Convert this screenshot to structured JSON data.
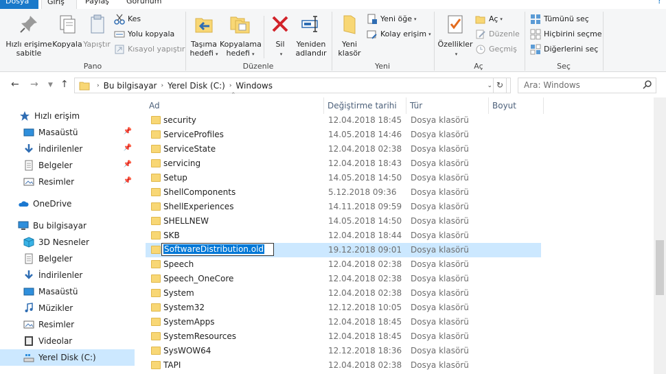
{
  "tabs": {
    "items": [
      "Dosya",
      "Giriş",
      "Paylaş",
      "Görünüm"
    ]
  },
  "ribbon": {
    "pano": {
      "label": "Pano",
      "pin": "Hızlı erişime sabitle",
      "copy": "Kopyala",
      "paste": "Yapıştır",
      "cut": "Kes",
      "copy_path": "Yolu kopyala",
      "paste_shortcut": "Kısayol yapıştır"
    },
    "duzenle": {
      "label": "Düzenle",
      "move_to": "Taşıma hedefi",
      "copy_to": "Kopyalama hedefi",
      "delete": "Sil",
      "rename": "Yeniden adlandır"
    },
    "yeni": {
      "label": "Yeni",
      "new_folder": "Yeni klasör",
      "new_item": "Yeni öğe",
      "easy_access": "Kolay erişim"
    },
    "ac": {
      "label": "Aç",
      "properties": "Özellikler",
      "open": "Aç",
      "edit": "Düzenle",
      "history": "Geçmiş"
    },
    "sec": {
      "label": "Seç",
      "select_all": "Tümünü seç",
      "select_none": "Hiçbirini seçme",
      "invert": "Diğerlerini seç"
    }
  },
  "address": {
    "crumbs": [
      "Bu bilgisayar",
      "Yerel Disk (C:)",
      "Windows"
    ],
    "search_placeholder": "Ara: Windows"
  },
  "nav": {
    "items": [
      {
        "label": "Hızlı erişim",
        "icon": "star-icon"
      },
      {
        "label": "Masaüstü",
        "icon": "desktop-icon"
      },
      {
        "label": "İndirilenler",
        "icon": "download-icon"
      },
      {
        "label": "Belgeler",
        "icon": "document-icon"
      },
      {
        "label": "Resimler",
        "icon": "pictures-icon"
      },
      {
        "label": "OneDrive",
        "icon": "cloud-icon"
      },
      {
        "label": "Bu bilgisayar",
        "icon": "computer-icon"
      },
      {
        "label": "3D Nesneler",
        "icon": "cube-icon"
      },
      {
        "label": "Belgeler",
        "icon": "document-icon"
      },
      {
        "label": "İndirilenler",
        "icon": "download-icon"
      },
      {
        "label": "Masaüstü",
        "icon": "desktop-icon"
      },
      {
        "label": "Müzikler",
        "icon": "music-icon"
      },
      {
        "label": "Resimler",
        "icon": "pictures-icon"
      },
      {
        "label": "Videolar",
        "icon": "video-icon"
      },
      {
        "label": "Yerel Disk (C:)",
        "icon": "drive-icon"
      }
    ]
  },
  "columns": {
    "name": "Ad",
    "modified": "Değiştirme tarihi",
    "type": "Tür",
    "size": "Boyut"
  },
  "files": [
    {
      "name": "security",
      "date": "12.04.2018 18:45",
      "type": "Dosya klasörü"
    },
    {
      "name": "ServiceProfiles",
      "date": "14.05.2018 14:46",
      "type": "Dosya klasörü"
    },
    {
      "name": "ServiceState",
      "date": "12.04.2018 02:38",
      "type": "Dosya klasörü"
    },
    {
      "name": "servicing",
      "date": "12.04.2018 18:43",
      "type": "Dosya klasörü"
    },
    {
      "name": "Setup",
      "date": "14.05.2018 14:50",
      "type": "Dosya klasörü"
    },
    {
      "name": "ShellComponents",
      "date": "5.12.2018 09:36",
      "type": "Dosya klasörü"
    },
    {
      "name": "ShellExperiences",
      "date": "14.11.2018 09:59",
      "type": "Dosya klasörü"
    },
    {
      "name": "SHELLNEW",
      "date": "14.05.2018 14:50",
      "type": "Dosya klasörü"
    },
    {
      "name": "SKB",
      "date": "12.04.2018 18:44",
      "type": "Dosya klasörü"
    },
    {
      "name": "SoftwareDistribution.old",
      "date": "19.12.2018 09:01",
      "type": "Dosya klasörü"
    },
    {
      "name": "Speech",
      "date": "12.04.2018 02:38",
      "type": "Dosya klasörü"
    },
    {
      "name": "Speech_OneCore",
      "date": "12.04.2018 02:38",
      "type": "Dosya klasörü"
    },
    {
      "name": "System",
      "date": "12.04.2018 02:38",
      "type": "Dosya klasörü"
    },
    {
      "name": "System32",
      "date": "12.12.2018 10:05",
      "type": "Dosya klasörü"
    },
    {
      "name": "SystemApps",
      "date": "12.04.2018 18:45",
      "type": "Dosya klasörü"
    },
    {
      "name": "SystemResources",
      "date": "12.04.2018 18:45",
      "type": "Dosya klasörü"
    },
    {
      "name": "SysWOW64",
      "date": "12.12.2018 18:36",
      "type": "Dosya klasörü"
    },
    {
      "name": "TAPI",
      "date": "12.04.2018 02:38",
      "type": "Dosya klasörü"
    }
  ],
  "colors": {
    "accent": "#1979ca",
    "selection": "#cce8ff",
    "rename_highlight": "#0078d7",
    "folder": "#f8d775"
  }
}
